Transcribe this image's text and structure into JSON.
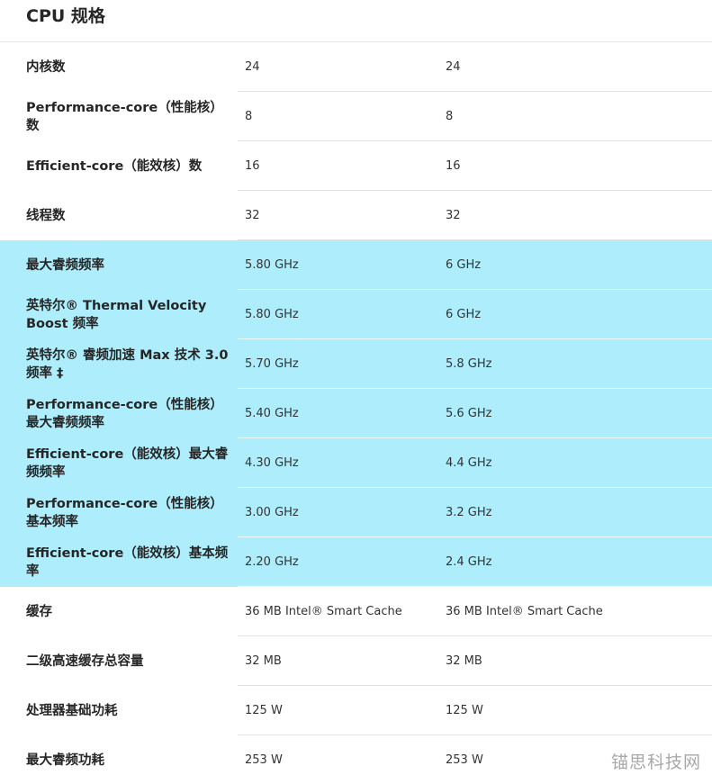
{
  "title": "CPU 规格",
  "rows": [
    {
      "label": "内核数",
      "v1": "24",
      "v2": "24",
      "highlight": false
    },
    {
      "label": "Performance-core（性能核）数",
      "v1": "8",
      "v2": "8",
      "highlight": false
    },
    {
      "label": "Efficient-core（能效核）数",
      "v1": "16",
      "v2": "16",
      "highlight": false
    },
    {
      "label": "线程数",
      "v1": "32",
      "v2": "32",
      "highlight": false
    },
    {
      "label": "最大睿频频率",
      "v1": "5.80 GHz",
      "v2": "6 GHz",
      "highlight": true
    },
    {
      "label": "英特尔® Thermal Velocity Boost 频率",
      "v1": "5.80 GHz",
      "v2": "6 GHz",
      "highlight": true
    },
    {
      "label": "英特尔® 睿频加速 Max 技术 3.0 频率 ‡",
      "v1": "5.70 GHz",
      "v2": "5.8 GHz",
      "highlight": true
    },
    {
      "label": "Performance-core（性能核）最大睿频频率",
      "v1": "5.40 GHz",
      "v2": "5.6 GHz",
      "highlight": true
    },
    {
      "label": "Efficient-core（能效核）最大睿频频率",
      "v1": "4.30 GHz",
      "v2": "4.4 GHz",
      "highlight": true
    },
    {
      "label": "Performance-core（性能核）基本频率",
      "v1": "3.00 GHz",
      "v2": "3.2 GHz",
      "highlight": true
    },
    {
      "label": "Efficient-core（能效核）基本频率",
      "v1": "2.20 GHz",
      "v2": "2.4 GHz",
      "highlight": true
    },
    {
      "label": "缓存",
      "v1": "36 MB Intel® Smart Cache",
      "v2": "36 MB Intel® Smart Cache",
      "highlight": false
    },
    {
      "label": "二级高速缓存总容量",
      "v1": "32 MB",
      "v2": "32 MB",
      "highlight": false
    },
    {
      "label": "处理器基础功耗",
      "v1": "125 W",
      "v2": "125 W",
      "highlight": false
    },
    {
      "label": "最大睿频功耗",
      "v1": "253 W",
      "v2": "253 W",
      "highlight": false
    }
  ],
  "watermark": "锚思科技网",
  "colors": {
    "highlight": "#aeeefc",
    "separator": "#e3e3e3",
    "text": "#262626"
  }
}
